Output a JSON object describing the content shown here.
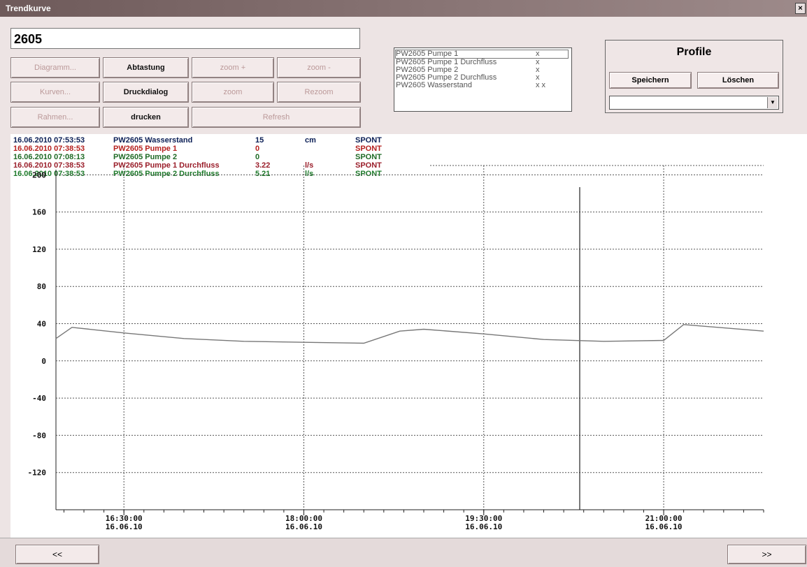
{
  "window": {
    "title": "Trendkurve",
    "close_glyph": "×"
  },
  "station": {
    "id": "2605"
  },
  "buttons": {
    "diagramm": "Diagramm...",
    "abtastung": "Abtastung",
    "zoom_plus": "zoom +",
    "zoom_minus": "zoom -",
    "kurven": "Kurven...",
    "druckdialog": "Druckdialog",
    "zoom": "zoom",
    "rezoom": "Rezoom",
    "rahmen": "Rahmen...",
    "drucken": "drucken",
    "refresh": "Refresh"
  },
  "curve_list": [
    {
      "label": "PW2605 Pumpe 1",
      "marks": "x"
    },
    {
      "label": "PW2605 Pumpe 1 Durchfluss",
      "marks": "x"
    },
    {
      "label": "PW2605 Pumpe 2",
      "marks": "x"
    },
    {
      "label": "PW2605 Pumpe 2 Durchfluss",
      "marks": "x"
    },
    {
      "label": "PW2605 Wasserstand",
      "marks": "x  x"
    }
  ],
  "profile": {
    "title": "Profile",
    "save_label": "Speichern",
    "delete_label": "Löschen",
    "selected": ""
  },
  "legend": [
    {
      "time": "16.06.2010 07:53:53",
      "name": "PW2605 Wasserstand",
      "value": "15",
      "unit": "cm",
      "status": "SPONT",
      "color": "#0a1e55"
    },
    {
      "time": "16.06.2010 07:38:53",
      "name": "PW2605 Pumpe 1",
      "value": "0",
      "unit": "",
      "status": "SPONT",
      "color": "#b5201e"
    },
    {
      "time": "16.06.2010 07:08:13",
      "name": "PW2605 Pumpe 2",
      "value": "0",
      "unit": "",
      "status": "SPONT",
      "color": "#1f6a25"
    },
    {
      "time": "16.06.2010 07:38:53",
      "name": "PW2605 Pumpe 1 Durchfluss",
      "value": "3.22",
      "unit": "l/s",
      "status": "SPONT",
      "color": "#9a1e2a"
    },
    {
      "time": "16.06.2010 07:38:53",
      "name": "PW2605 Pumpe 2 Durchfluss",
      "value": "5.21",
      "unit": "l/s",
      "status": "SPONT",
      "color": "#1d7a2a"
    }
  ],
  "chart_data": {
    "type": "line",
    "y_ticks": [
      200,
      160,
      120,
      80,
      40,
      0,
      -40,
      -80,
      -120
    ],
    "ylim": [
      -160,
      210
    ],
    "x_ticks": [
      {
        "time": "16:30:00",
        "date": "16.06.10"
      },
      {
        "time": "18:00:00",
        "date": "16.06.10"
      },
      {
        "time": "19:30:00",
        "date": "16.06.10"
      },
      {
        "time": "21:00:00",
        "date": "16.06.10"
      }
    ],
    "xlim": [
      "15:56",
      "21:50"
    ],
    "cursor_time": "20:18",
    "grid": true,
    "series": [
      {
        "color": "#777777",
        "x": [
          "15:56",
          "16:04",
          "16:30",
          "17:00",
          "17:30",
          "18:00",
          "18:30",
          "18:48",
          "19:00",
          "19:30",
          "20:00",
          "20:30",
          "21:00",
          "21:10",
          "21:50"
        ],
        "y": [
          24,
          36,
          30,
          24,
          21,
          20,
          19,
          32,
          34,
          29,
          23,
          21,
          22,
          39,
          32
        ]
      }
    ]
  },
  "nav": {
    "prev": "<<",
    "next": ">>"
  }
}
